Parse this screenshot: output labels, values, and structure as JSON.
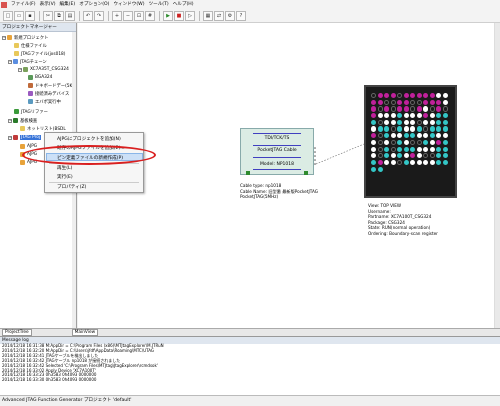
{
  "menu": [
    "ファイル(F)",
    "表示(V)",
    "編集(E)",
    "オプション(O)",
    "ウィンドウ(W)",
    "ツール(T)",
    "ヘルプ(H)"
  ],
  "panel_title": "プロジェクトマネージャー",
  "tree": [
    {
      "label": "新規プロジェクト"
    },
    {
      "label": "仕様ファイル"
    },
    {
      "label": "JTAGファイル(jxs018)"
    },
    {
      "label": "JTAGチェーン"
    },
    {
      "label": "XC7A35T_CSG324"
    },
    {
      "label": "BGA324"
    },
    {
      "label": "ドキボードデー(5KN"
    },
    {
      "label": "接続済みデバイス"
    },
    {
      "label": "エバポ実行中"
    },
    {
      "label": "JTAGリファー"
    },
    {
      "label": "基板検査"
    },
    {
      "label": "ネットリスト(BSDL"
    },
    {
      "label": "JTAG Proj"
    },
    {
      "label": "AJPG"
    },
    {
      "label": "AJPG"
    },
    {
      "label": "AJPG"
    }
  ],
  "context_menu": {
    "items": [
      "AJPGにプロジェクトを追加(N)",
      "既存のAJPGファイルを追加(E)...",
      "ピン定義ファイルの新規作成(P)",
      "再生(L)",
      "実行(E)",
      "プロパティ(Z)"
    ],
    "highlighted_index": 2
  },
  "cable": {
    "top": "TDI/TCK/TS",
    "middle": "PocketJTAG Cable",
    "bottom": "Model: NP1018",
    "info": [
      "Cable type: np1018",
      "Cable Name: 旧型番 最新版PocketJTAG",
      "PocketJTAG(5MHz)"
    ]
  },
  "view_info": [
    "View: TOP VIEW",
    "Username:",
    "Partname: XC7A100T_CSG324",
    "Package: CSG324",
    "State: RUN(normal operation)",
    "Ordering: Boundary-scan register"
  ],
  "chip_pattern": "KMMMKMMMMMWWMMKKMMKKMMMWMKMKMMKMWKMKMWWWCWWWMWCCCKWWCWWKWWCCWCCKCWWCKCCCMKCWWCCWWCWWWKWKCWKKCWMCWKCKCCCWWWCCWKCWCWMWKKCCCMWWKCWWWWCCCC",
  "chip_colors": {
    "K": "#1a1a1a",
    "M": "#c0209b",
    "W": "#ffffff",
    "C": "#33c6c6"
  },
  "tabs": [
    "ProjectTree",
    "MainView"
  ],
  "log_title": "Message log",
  "log": [
    "2014/12/18 16:31:38 M:AppDir = C:\\Program Files (x86)\\MTJtagExplorer\\M.JTRuN",
    "2014/12/18 16:32:20 M:AppDir = C:\\Users\\jfdf\\AppData\\Roaming\\MTC\\UTAG",
    "2014/12/18 16:32:41 JTAGケーブルを検出しました",
    "2014/12/18 16:32:42 JTAGケーブル np1018 が接続されました",
    "2014/12/18 16:32:42 Selected 'C:\\Program Files\\MTJtag\\JtagExplorer\\rcmdsok'",
    "2014/12/18 16:33:02 Apply Device 'XC7A100T'",
    "2014/12/18 16:33:23 0h3583 0h4093 0000000",
    "2014/12/18 16:33:30 0h3583 0h4093 0000000"
  ],
  "status": "Advanced JTAG Function Generator プロジェクト 'default'"
}
